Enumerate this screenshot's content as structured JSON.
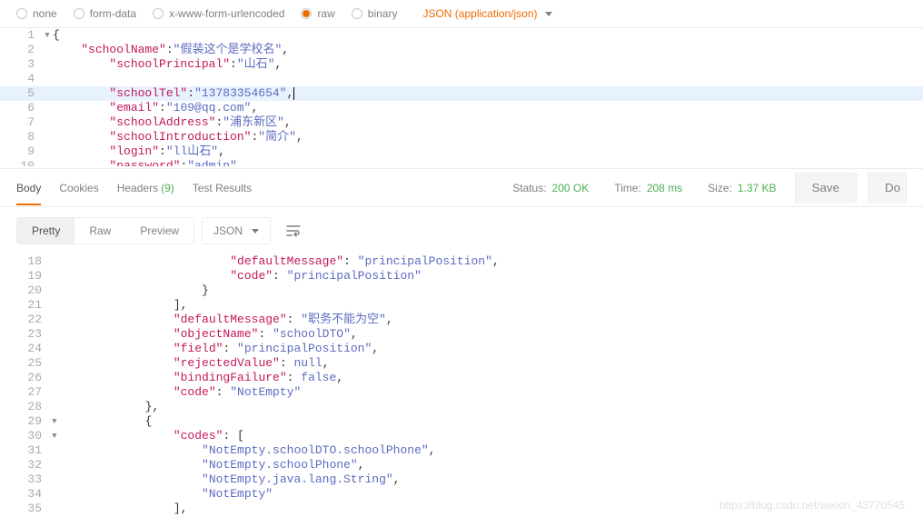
{
  "bodyTypes": {
    "none": "none",
    "formData": "form-data",
    "urlencoded": "x-www-form-urlencoded",
    "raw": "raw",
    "binary": "binary",
    "selected": "raw",
    "contentType": "JSON (application/json)"
  },
  "request": {
    "lines": [
      {
        "n": 1,
        "fold": "▾",
        "indent": 0,
        "tokens": [
          {
            "t": "p-brace",
            "v": "{"
          }
        ]
      },
      {
        "n": 2,
        "indent": 1,
        "tokens": [
          {
            "t": "p-key",
            "v": "\"schoolName\""
          },
          {
            "t": "p-colon",
            "v": ":"
          },
          {
            "t": "p-str",
            "v": "\"假装这个是学校名\""
          },
          {
            "t": "p-colon",
            "v": ","
          }
        ]
      },
      {
        "n": 3,
        "indent": 2,
        "tokens": [
          {
            "t": "p-key",
            "v": "\"schoolPrincipal\""
          },
          {
            "t": "p-colon",
            "v": ":"
          },
          {
            "t": "p-str",
            "v": "\"山石\""
          },
          {
            "t": "p-colon",
            "v": ","
          }
        ]
      },
      {
        "n": 4,
        "indent": 0,
        "tokens": []
      },
      {
        "n": 5,
        "hl": true,
        "indent": 2,
        "tokens": [
          {
            "t": "p-key",
            "v": "\"schoolTel\""
          },
          {
            "t": "p-colon",
            "v": ":"
          },
          {
            "t": "p-str",
            "v": "\"13783354654\""
          },
          {
            "t": "p-colon",
            "v": ","
          }
        ],
        "cursor": true
      },
      {
        "n": 6,
        "indent": 2,
        "tokens": [
          {
            "t": "p-key",
            "v": "\"email\""
          },
          {
            "t": "p-colon",
            "v": ":"
          },
          {
            "t": "p-str",
            "v": "\"109@qq.com\""
          },
          {
            "t": "p-colon",
            "v": ","
          }
        ]
      },
      {
        "n": 7,
        "indent": 2,
        "tokens": [
          {
            "t": "p-key",
            "v": "\"schoolAddress\""
          },
          {
            "t": "p-colon",
            "v": ":"
          },
          {
            "t": "p-str",
            "v": "\"浦东新区\""
          },
          {
            "t": "p-colon",
            "v": ","
          }
        ]
      },
      {
        "n": 8,
        "indent": 2,
        "tokens": [
          {
            "t": "p-key",
            "v": "\"schoolIntroduction\""
          },
          {
            "t": "p-colon",
            "v": ":"
          },
          {
            "t": "p-str",
            "v": "\"简介\""
          },
          {
            "t": "p-colon",
            "v": ","
          }
        ]
      },
      {
        "n": 9,
        "indent": 2,
        "tokens": [
          {
            "t": "p-key",
            "v": "\"login\""
          },
          {
            "t": "p-colon",
            "v": ":"
          },
          {
            "t": "p-str",
            "v": "\"ll山石\""
          },
          {
            "t": "p-colon",
            "v": ","
          }
        ]
      },
      {
        "n": 10,
        "cut": true,
        "indent": 2,
        "tokens": [
          {
            "t": "p-key",
            "v": "\"password\""
          },
          {
            "t": "p-colon",
            "v": ":"
          },
          {
            "t": "p-str",
            "v": "\"admin\""
          }
        ]
      }
    ]
  },
  "responseTabs": {
    "body": "Body",
    "cookies": "Cookies",
    "headers": "Headers",
    "headersCount": "(9)",
    "testResults": "Test Results",
    "active": "Body"
  },
  "status": {
    "statusLabel": "Status:",
    "statusValue": "200 OK",
    "timeLabel": "Time:",
    "timeValue": "208 ms",
    "sizeLabel": "Size:",
    "sizeValue": "1.37 KB",
    "saveBtn": "Save",
    "downloadBtn": "Do"
  },
  "viewBar": {
    "pretty": "Pretty",
    "raw": "Raw",
    "preview": "Preview",
    "format": "JSON"
  },
  "response": {
    "lines": [
      {
        "n": 18,
        "indent": 24,
        "tokens": [
          {
            "t": "j-key",
            "v": "\"defaultMessage\""
          },
          {
            "t": "j-p",
            "v": ": "
          },
          {
            "t": "j-str",
            "v": "\"principalPosition\""
          },
          {
            "t": "j-p",
            "v": ","
          }
        ]
      },
      {
        "n": 19,
        "indent": 24,
        "tokens": [
          {
            "t": "j-key",
            "v": "\"code\""
          },
          {
            "t": "j-p",
            "v": ": "
          },
          {
            "t": "j-str",
            "v": "\"principalPosition\""
          }
        ]
      },
      {
        "n": 20,
        "indent": 20,
        "tokens": [
          {
            "t": "j-p",
            "v": "}"
          }
        ]
      },
      {
        "n": 21,
        "indent": 16,
        "tokens": [
          {
            "t": "j-p",
            "v": "],"
          }
        ]
      },
      {
        "n": 22,
        "indent": 16,
        "tokens": [
          {
            "t": "j-key",
            "v": "\"defaultMessage\""
          },
          {
            "t": "j-p",
            "v": ": "
          },
          {
            "t": "j-str",
            "v": "\"职务不能为空\""
          },
          {
            "t": "j-p",
            "v": ","
          }
        ]
      },
      {
        "n": 23,
        "indent": 16,
        "tokens": [
          {
            "t": "j-key",
            "v": "\"objectName\""
          },
          {
            "t": "j-p",
            "v": ": "
          },
          {
            "t": "j-str",
            "v": "\"schoolDTO\""
          },
          {
            "t": "j-p",
            "v": ","
          }
        ]
      },
      {
        "n": 24,
        "indent": 16,
        "tokens": [
          {
            "t": "j-key",
            "v": "\"field\""
          },
          {
            "t": "j-p",
            "v": ": "
          },
          {
            "t": "j-str",
            "v": "\"principalPosition\""
          },
          {
            "t": "j-p",
            "v": ","
          }
        ]
      },
      {
        "n": 25,
        "indent": 16,
        "tokens": [
          {
            "t": "j-key",
            "v": "\"rejectedValue\""
          },
          {
            "t": "j-p",
            "v": ": "
          },
          {
            "t": "j-kw",
            "v": "null"
          },
          {
            "t": "j-p",
            "v": ","
          }
        ]
      },
      {
        "n": 26,
        "indent": 16,
        "tokens": [
          {
            "t": "j-key",
            "v": "\"bindingFailure\""
          },
          {
            "t": "j-p",
            "v": ": "
          },
          {
            "t": "j-kw",
            "v": "false"
          },
          {
            "t": "j-p",
            "v": ","
          }
        ]
      },
      {
        "n": 27,
        "indent": 16,
        "tokens": [
          {
            "t": "j-key",
            "v": "\"code\""
          },
          {
            "t": "j-p",
            "v": ": "
          },
          {
            "t": "j-str",
            "v": "\"NotEmpty\""
          }
        ]
      },
      {
        "n": 28,
        "indent": 12,
        "tokens": [
          {
            "t": "j-p",
            "v": "},"
          }
        ]
      },
      {
        "n": 29,
        "fold": "▾",
        "indent": 12,
        "tokens": [
          {
            "t": "j-p",
            "v": "{"
          }
        ]
      },
      {
        "n": 30,
        "fold": "▾",
        "indent": 16,
        "tokens": [
          {
            "t": "j-key",
            "v": "\"codes\""
          },
          {
            "t": "j-p",
            "v": ": ["
          }
        ]
      },
      {
        "n": 31,
        "indent": 20,
        "tokens": [
          {
            "t": "j-str",
            "v": "\"NotEmpty.schoolDTO.schoolPhone\""
          },
          {
            "t": "j-p",
            "v": ","
          }
        ]
      },
      {
        "n": 32,
        "indent": 20,
        "tokens": [
          {
            "t": "j-str",
            "v": "\"NotEmpty.schoolPhone\""
          },
          {
            "t": "j-p",
            "v": ","
          }
        ]
      },
      {
        "n": 33,
        "indent": 20,
        "tokens": [
          {
            "t": "j-str",
            "v": "\"NotEmpty.java.lang.String\""
          },
          {
            "t": "j-p",
            "v": ","
          }
        ]
      },
      {
        "n": 34,
        "indent": 20,
        "tokens": [
          {
            "t": "j-str",
            "v": "\"NotEmpty\""
          }
        ]
      },
      {
        "n": 35,
        "indent": 16,
        "tokens": [
          {
            "t": "j-p",
            "v": "],"
          }
        ]
      }
    ]
  },
  "watermark": "https://blog.csdn.net/weixin_43770545"
}
